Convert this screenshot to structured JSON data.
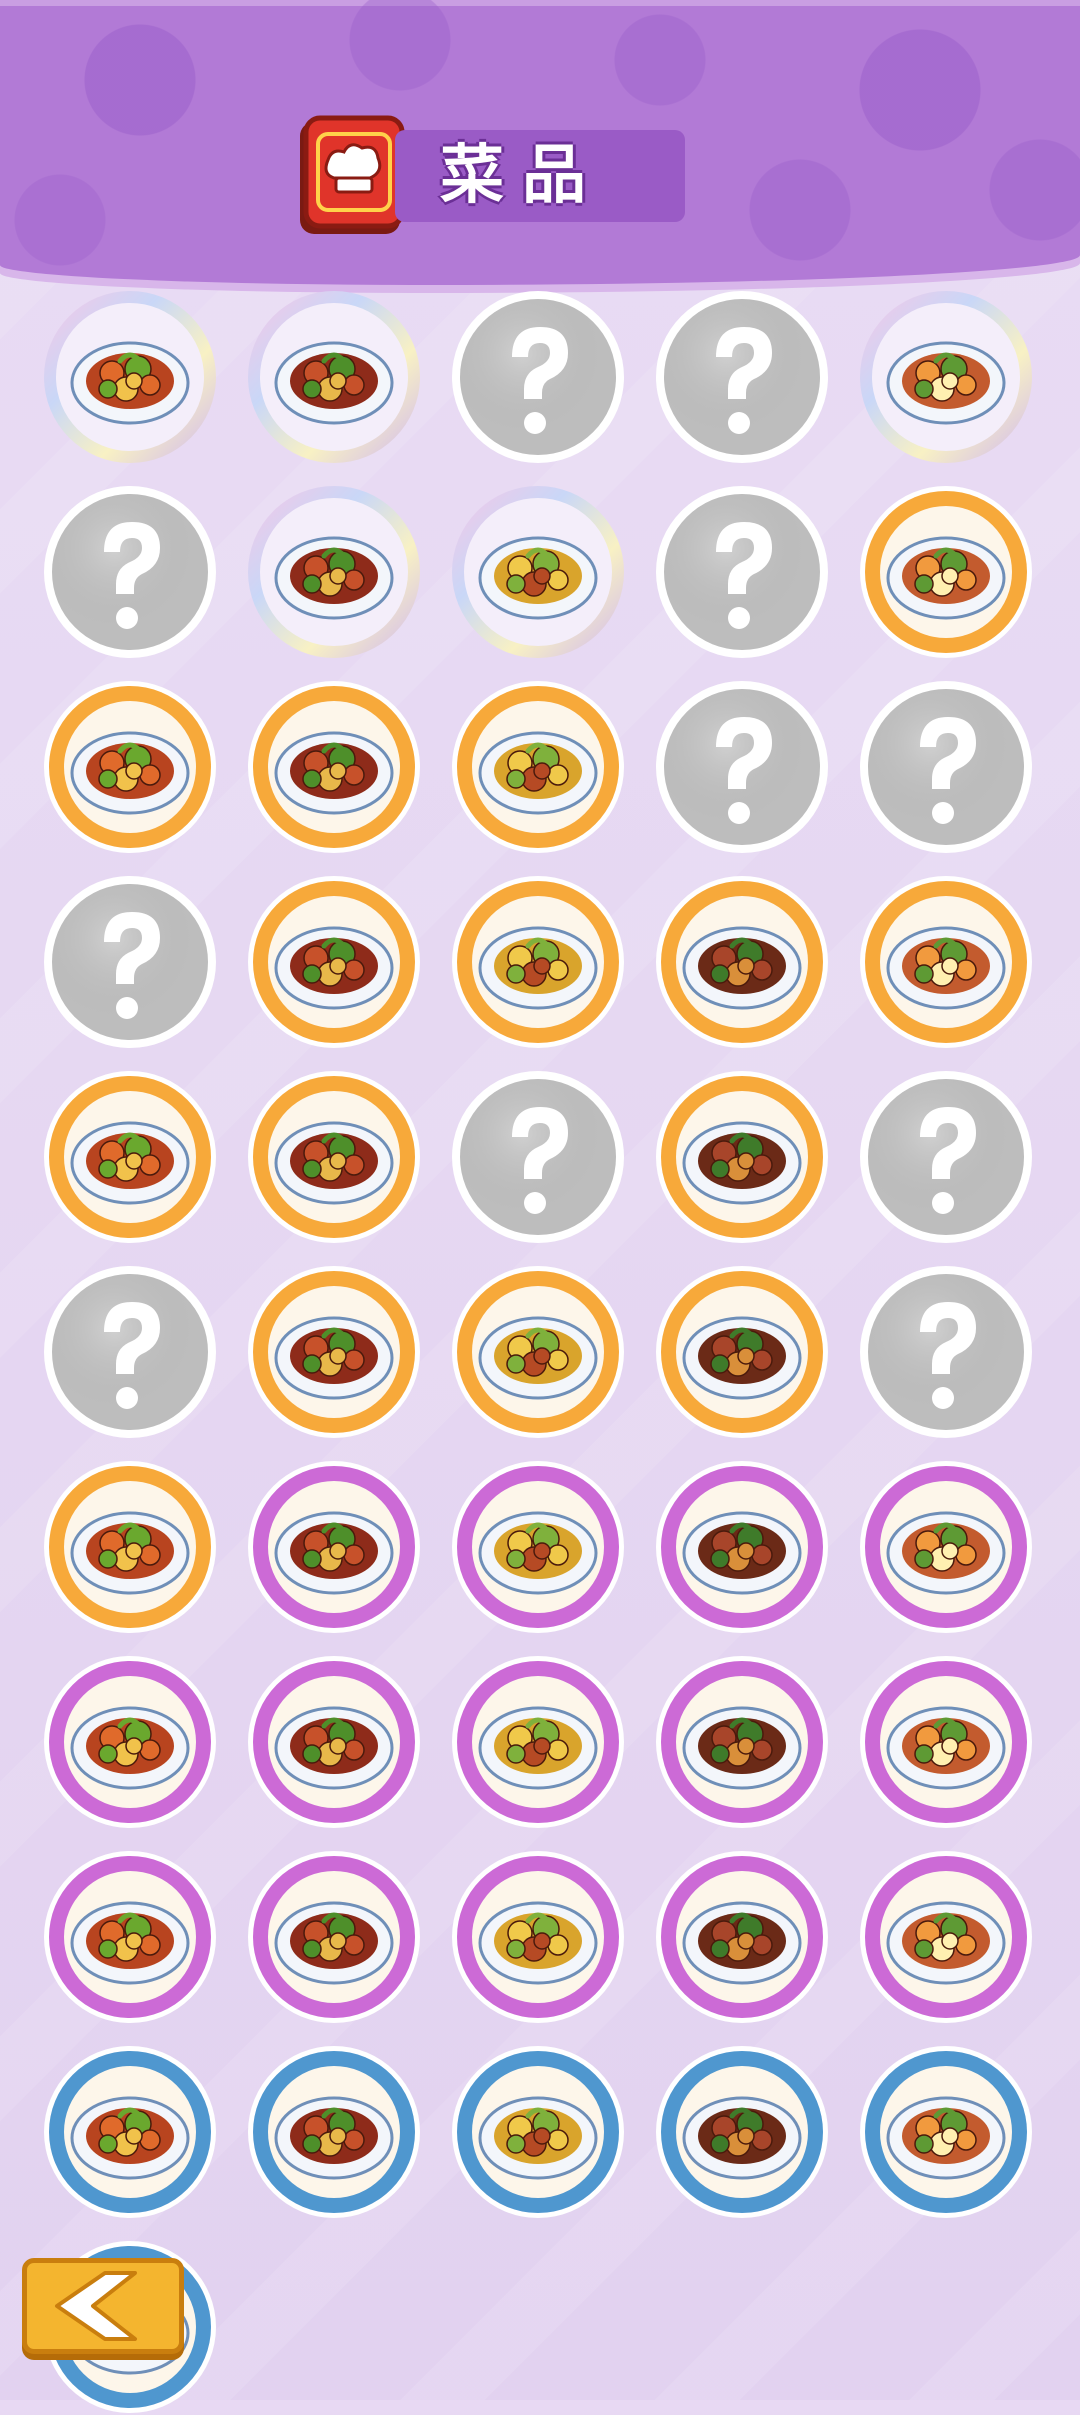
{
  "header": {
    "title": "菜品",
    "icon": "recipe-book-icon"
  },
  "colors": {
    "rainbow": "#c9b8e8",
    "orange": "#f7a93a",
    "purple": "#cc6ad6",
    "blue": "#4f97cf",
    "locked": "#bdbdbd"
  },
  "dishes": [
    {
      "state": "rainbow",
      "icon": "soup-pot-icon"
    },
    {
      "state": "rainbow",
      "icon": "kung-pao-icon"
    },
    {
      "state": "locked",
      "icon": "question-mark-icon"
    },
    {
      "state": "locked",
      "icon": "question-mark-icon"
    },
    {
      "state": "rainbow",
      "icon": "egg-custard-icon"
    },
    {
      "state": "locked",
      "icon": "question-mark-icon"
    },
    {
      "state": "rainbow",
      "icon": "fish-head-icon"
    },
    {
      "state": "rainbow",
      "icon": "braised-pork-icon"
    },
    {
      "state": "locked",
      "icon": "question-mark-icon"
    },
    {
      "state": "orange",
      "icon": "dongpo-pork-icon"
    },
    {
      "state": "orange",
      "icon": "stir-fry-beans-icon"
    },
    {
      "state": "orange",
      "icon": "chicken-stir-fry-icon"
    },
    {
      "state": "orange",
      "icon": "claypot-icon"
    },
    {
      "state": "locked",
      "icon": "question-mark-icon"
    },
    {
      "state": "locked",
      "icon": "question-mark-icon"
    },
    {
      "state": "locked",
      "icon": "question-mark-icon"
    },
    {
      "state": "orange",
      "icon": "mapo-tofu-icon"
    },
    {
      "state": "orange",
      "icon": "coconut-soup-icon"
    },
    {
      "state": "orange",
      "icon": "meatballs-icon"
    },
    {
      "state": "orange",
      "icon": "cabbage-icon"
    },
    {
      "state": "orange",
      "icon": "pepper-beef-icon"
    },
    {
      "state": "orange",
      "icon": "red-braised-pork-icon"
    },
    {
      "state": "locked",
      "icon": "question-mark-icon"
    },
    {
      "state": "orange",
      "icon": "beef-stew-icon"
    },
    {
      "state": "locked",
      "icon": "question-mark-icon"
    },
    {
      "state": "locked",
      "icon": "question-mark-icon"
    },
    {
      "state": "orange",
      "icon": "braised-eggs-icon"
    },
    {
      "state": "orange",
      "icon": "roast-duck-icon"
    },
    {
      "state": "orange",
      "icon": "dumplings-icon"
    },
    {
      "state": "locked",
      "icon": "question-mark-icon"
    },
    {
      "state": "orange",
      "icon": "roast-meat-icon"
    },
    {
      "state": "purple",
      "icon": "eggplant-icon"
    },
    {
      "state": "purple",
      "icon": "seaweed-icon"
    },
    {
      "state": "purple",
      "icon": "tofu-stir-fry-icon"
    },
    {
      "state": "purple",
      "icon": "skewers-icon"
    },
    {
      "state": "purple",
      "icon": "fried-chicken-icon"
    },
    {
      "state": "purple",
      "icon": "egg-soup-icon"
    },
    {
      "state": "purple",
      "icon": "wonton-icon"
    },
    {
      "state": "purple",
      "icon": "ramen-icon"
    },
    {
      "state": "purple",
      "icon": "burger-icon"
    },
    {
      "state": "purple",
      "icon": "bean-stew-icon"
    },
    {
      "state": "purple",
      "icon": "greens-icon"
    },
    {
      "state": "purple",
      "icon": "noodle-soup-icon"
    },
    {
      "state": "purple",
      "icon": "oysters-icon"
    },
    {
      "state": "purple",
      "icon": "lemon-tea-icon"
    },
    {
      "state": "blue",
      "icon": "potato-strips-icon"
    },
    {
      "state": "blue",
      "icon": "scrambled-egg-icon"
    },
    {
      "state": "blue",
      "icon": "egg-rice-bowl-icon"
    },
    {
      "state": "blue",
      "icon": "fried-egg-noodles-icon"
    },
    {
      "state": "blue",
      "icon": "green-noodles-icon"
    },
    {
      "state": "blue",
      "icon": "noodle-bowl-icon"
    }
  ],
  "back_button": {
    "icon": "back-arrow-icon"
  }
}
